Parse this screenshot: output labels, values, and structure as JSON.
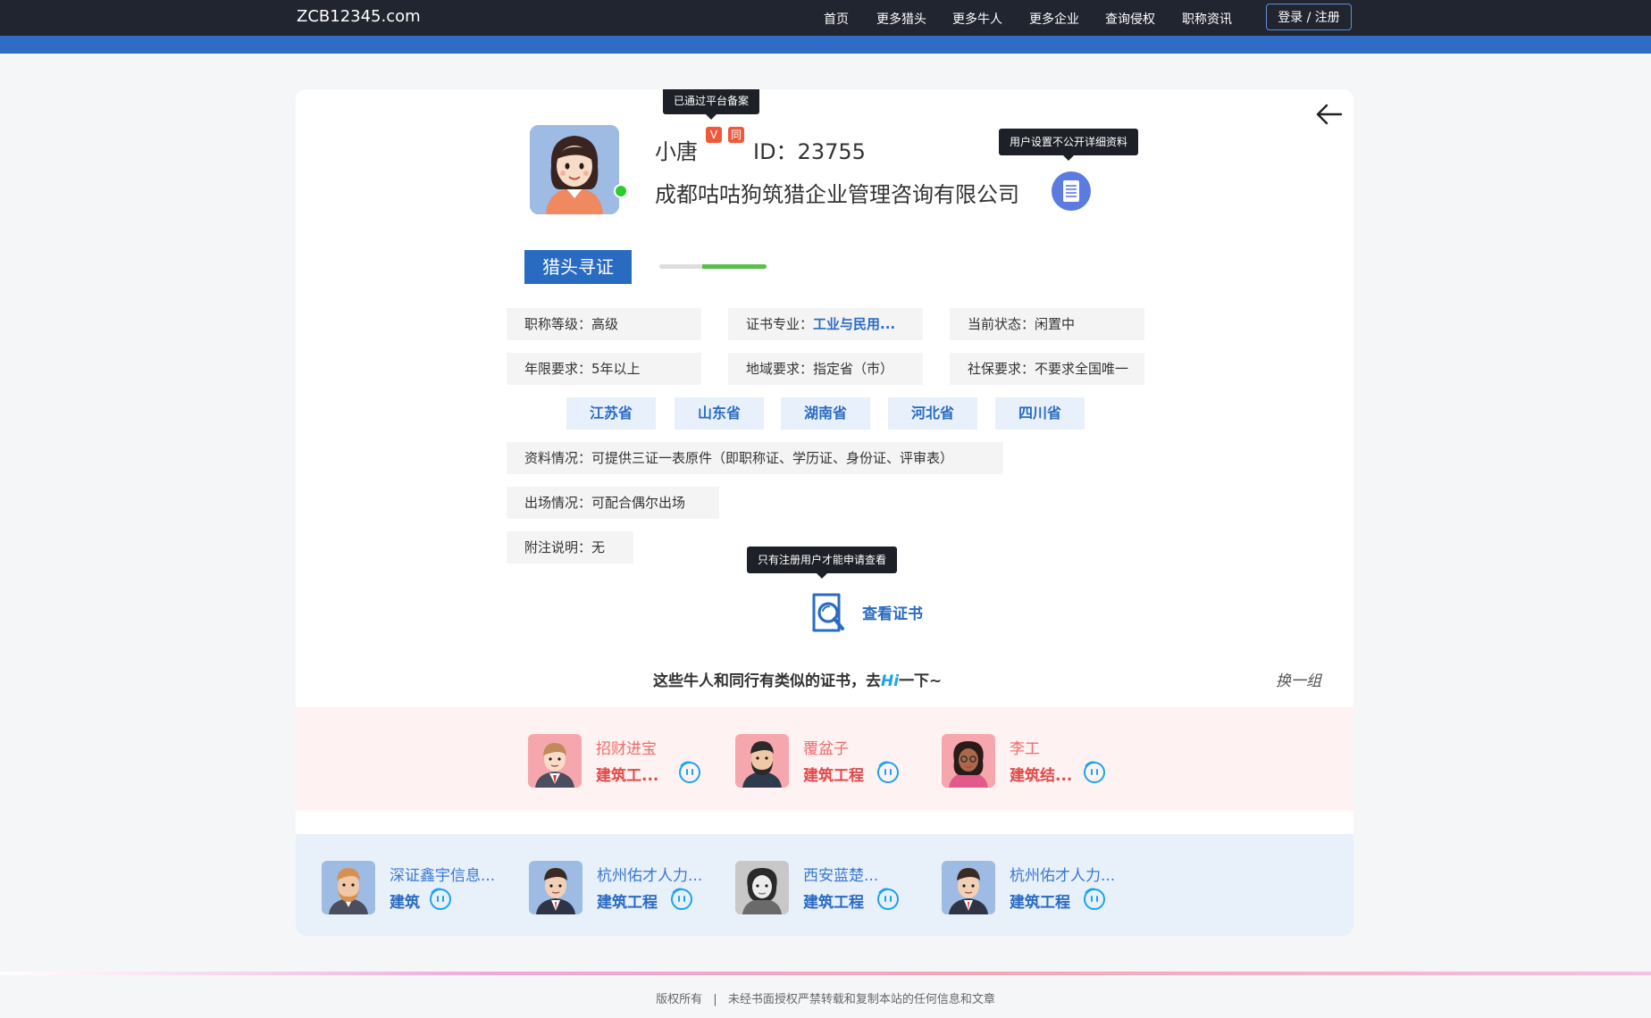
{
  "header": {
    "brand": "ZCB12345.com",
    "nav": [
      "首页",
      "更多猎头",
      "更多牛人",
      "更多企业",
      "查询侵权",
      "职称资讯"
    ],
    "login": "登录 / 注册"
  },
  "profile": {
    "tooltip_verified": "已通过平台备案",
    "name": "小唐",
    "badge_v": "V",
    "badge_tong": "同",
    "id_text": "ID：23755",
    "company": "成都咕咕狗筑猎企业管理咨询有限公司",
    "tooltip_private": "用户设置不公开详细资料",
    "role_button": "猎头寻证",
    "progress": 0.6
  },
  "info": {
    "level_label": "职称等级：",
    "level_value": "高级",
    "major_label": "证书专业：",
    "major_value": "工业与民用...",
    "status_label": "当前状态：",
    "status_value": "闲置中",
    "years_label": "年限要求：",
    "years_value": "5年以上",
    "region_label": "地域要求：",
    "region_value": "指定省（市）",
    "social_label": "社保要求：",
    "social_value": "不要求全国唯一",
    "provinces": [
      "江苏省",
      "山东省",
      "湖南省",
      "河北省",
      "四川省"
    ],
    "docs_label": "资料情况：",
    "docs_value": "可提供三证一表原件（即职称证、学历证、身份证、评审表）",
    "appear_label": "出场情况：",
    "appear_value": "可配合偶尔出场",
    "note_label": "附注说明：",
    "note_value": "无"
  },
  "view_cert": {
    "tooltip": "只有注册用户才能申请查看",
    "label": "查看证书"
  },
  "similar": {
    "title_pre": "这些牛人和同行有类似的证书，去",
    "title_hi": "Hi",
    "title_post": "一下~",
    "swap": "换一组"
  },
  "pink_people": [
    {
      "name": "招财进宝",
      "cert": "建筑工..."
    },
    {
      "name": "覆盆子",
      "cert": "建筑工程"
    },
    {
      "name": "李工",
      "cert": "建筑结..."
    }
  ],
  "blue_people": [
    {
      "name": "深证鑫宇信息...",
      "cert": "建筑"
    },
    {
      "name": "杭州佑才人力...",
      "cert": "建筑工程"
    },
    {
      "name": "西安蓝楚...",
      "cert": "建筑工程"
    },
    {
      "name": "杭州佑才人力...",
      "cert": "建筑工程"
    }
  ],
  "footer": {
    "copyright": "版权所有",
    "sep": "|",
    "notice": "未经书面授权严禁转载和复制本站的任何信息和文章"
  },
  "colors": {
    "topbar": "#212530",
    "band": "#2f6cc6",
    "accent": "#2a6bc2",
    "badge": "#f0583a",
    "pink_row": "#fff2f2",
    "blue_row": "#e8f0fa"
  }
}
